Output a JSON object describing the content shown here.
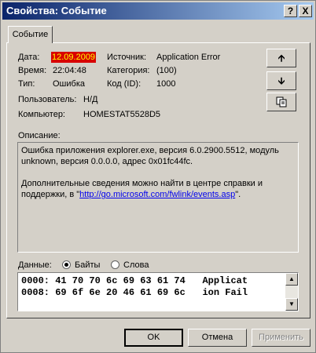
{
  "window": {
    "title": "Свойства: Событие",
    "help_button": "?",
    "close_button": "X"
  },
  "tab": {
    "label": "Событие"
  },
  "fields": {
    "date_label": "Дата:",
    "date_value": "12.09.2009",
    "time_label": "Время:",
    "time_value": "22:04:48",
    "type_label": "Тип:",
    "type_value": "Ошибка",
    "user_label": "Пользователь:",
    "user_value": "Н/Д",
    "computer_label": "Компьютер:",
    "computer_value": "HOMESTAT5528D5",
    "source_label": "Источник:",
    "source_value": "Application Error",
    "category_label": "Категория:",
    "category_value": "(100)",
    "code_label": "Код (ID):",
    "code_value": "1000"
  },
  "nav_buttons": {
    "up_icon": "arrow-up-icon",
    "down_icon": "arrow-down-icon",
    "copy_icon": "copy-icon"
  },
  "description": {
    "label": "Описание:",
    "line1": "Ошибка приложения explorer.exe, версия 6.0.2900.5512, модуль",
    "line2": "unknown, версия 0.0.0.0, адрес 0x01fc44fc.",
    "line3": "Дополнительные сведения можно найти в центре справки и",
    "line4_prefix": "поддержки, в \"",
    "link": "http://go.microsoft.com/fwlink/events.asp",
    "line4_suffix": "\"."
  },
  "data_section": {
    "label": "Данные:",
    "bytes_option": "Байты",
    "words_option": "Слова",
    "selected": "Байты",
    "hex_lines": [
      "0000: 41 70 70 6c 69 63 61 74   Applicat",
      "0008: 69 6f 6e 20 46 61 69 6c   ion Fail"
    ]
  },
  "buttons": {
    "ok": "OK",
    "cancel": "Отмена",
    "apply": "Применить"
  }
}
